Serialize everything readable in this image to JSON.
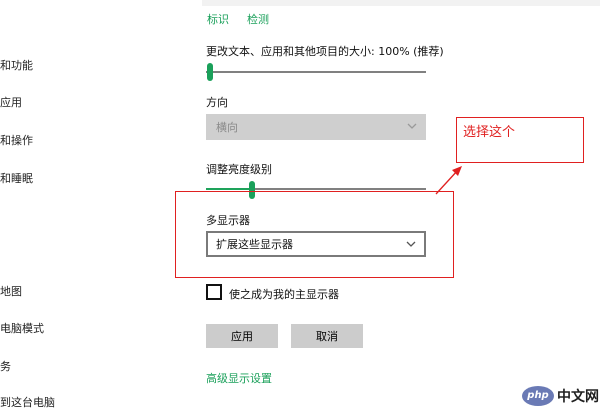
{
  "sidebar": {
    "items": [
      {
        "label": "和功能"
      },
      {
        "label": "应用"
      },
      {
        "label": "和操作"
      },
      {
        "label": "和睡眠"
      },
      {
        "label": "地图"
      },
      {
        "label": "电脑模式"
      },
      {
        "label": "务"
      },
      {
        "label": "到这台电脑"
      }
    ]
  },
  "main": {
    "top_links": {
      "identify": "标识",
      "detect": "检测"
    },
    "scale": {
      "label": "更改文本、应用和其他项目的大小: 100% (推荐)",
      "value_percent": 100,
      "position_fraction": 0.0
    },
    "orientation": {
      "label": "方向",
      "selected": "横向",
      "disabled": true
    },
    "brightness": {
      "label": "调整亮度级别",
      "position_fraction": 0.2
    },
    "multi_display": {
      "label": "多显示器",
      "selected": "扩展这些显示器"
    },
    "main_display_checkbox": {
      "label": "使之成为我的主显示器",
      "checked": false
    },
    "buttons": {
      "apply": "应用",
      "cancel": "取消"
    },
    "advanced_link": "高级显示设置"
  },
  "annotation": {
    "text": "选择这个",
    "color": "#e02020"
  },
  "watermark": {
    "badge": "php",
    "text": "中文网"
  },
  "colors": {
    "accent": "#1aa05a",
    "annotation": "#e02020"
  }
}
